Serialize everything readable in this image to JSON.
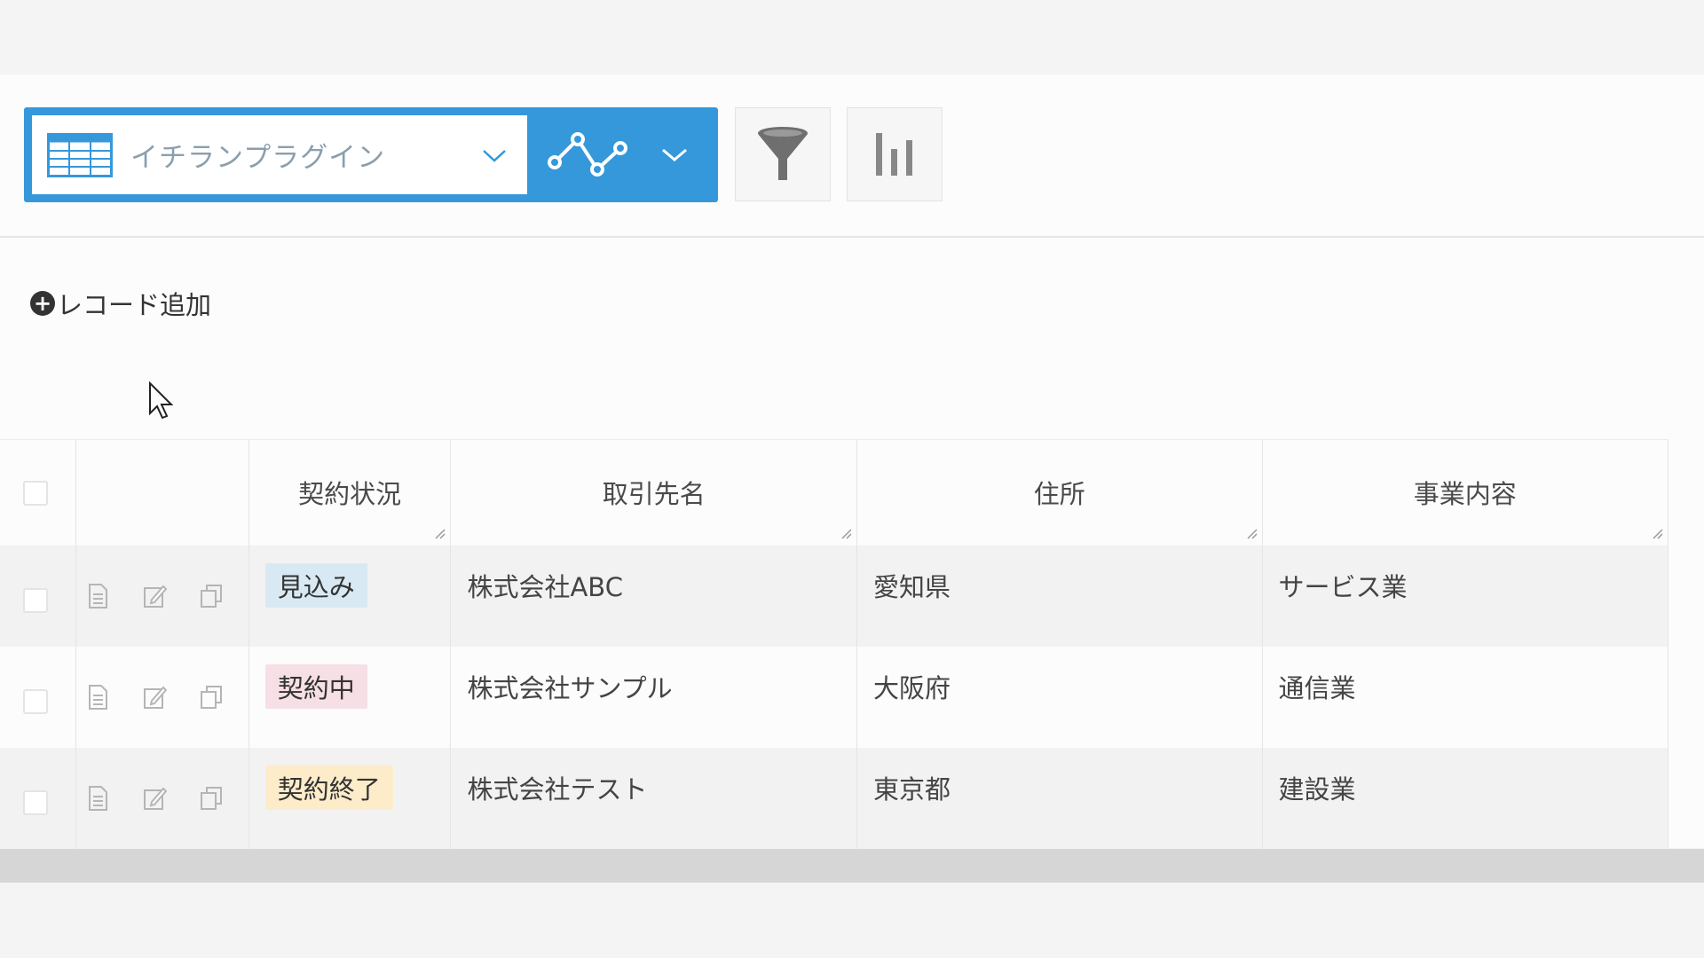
{
  "toolbar": {
    "view_name": "イチランプラグイン",
    "table_icon": "table-icon",
    "graph_icon": "line-graph-icon",
    "filter_icon": "funnel-icon",
    "graph_settings_icon": "bar-chart-icon",
    "accent_color": "#3498db"
  },
  "add_record": {
    "label": "レコード追加",
    "icon": "plus-circle-icon"
  },
  "table": {
    "headers": [
      "契約状況",
      "取引先名",
      "住所",
      "事業内容"
    ],
    "rows": [
      {
        "status": "見込み",
        "status_color": "#d8e9f3",
        "name": "株式会社ABC",
        "address": "愛知県",
        "business": "サービス業"
      },
      {
        "status": "契約中",
        "status_color": "#f6dfe5",
        "name": "株式会社サンプル",
        "address": "大阪府",
        "business": "通信業"
      },
      {
        "status": "契約終了",
        "status_color": "#fdecc9",
        "name": "株式会社テスト",
        "address": "東京都",
        "business": "建設業"
      }
    ]
  }
}
